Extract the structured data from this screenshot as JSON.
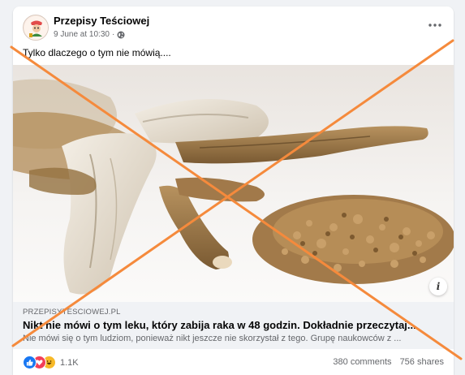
{
  "post": {
    "page_name": "Przepisy Teściowej",
    "date": "9 June at 10:30",
    "date_separator": "·",
    "privacy_icon": "globe-icon",
    "more_icon": "more-icon",
    "text": "Tylko dlaczego o tym nie mówią...."
  },
  "link": {
    "domain": "PRZEPISYTESCIOWEJ.PL",
    "title": "Nikt nie mówi o tym leku, który zabija raka w 48 godzin. Dokładnie przeczytaj...",
    "description": "Nie mówi się o tym ludziom, ponieważ nikt jeszcze nie skorzystał z tego. Grupę naukowców z ...",
    "info_label": "i"
  },
  "stats": {
    "reaction_count": "1.1K",
    "comments": "380 comments",
    "shares": "756 shares"
  },
  "overlay": {
    "cross_color": "#f58a3c"
  }
}
